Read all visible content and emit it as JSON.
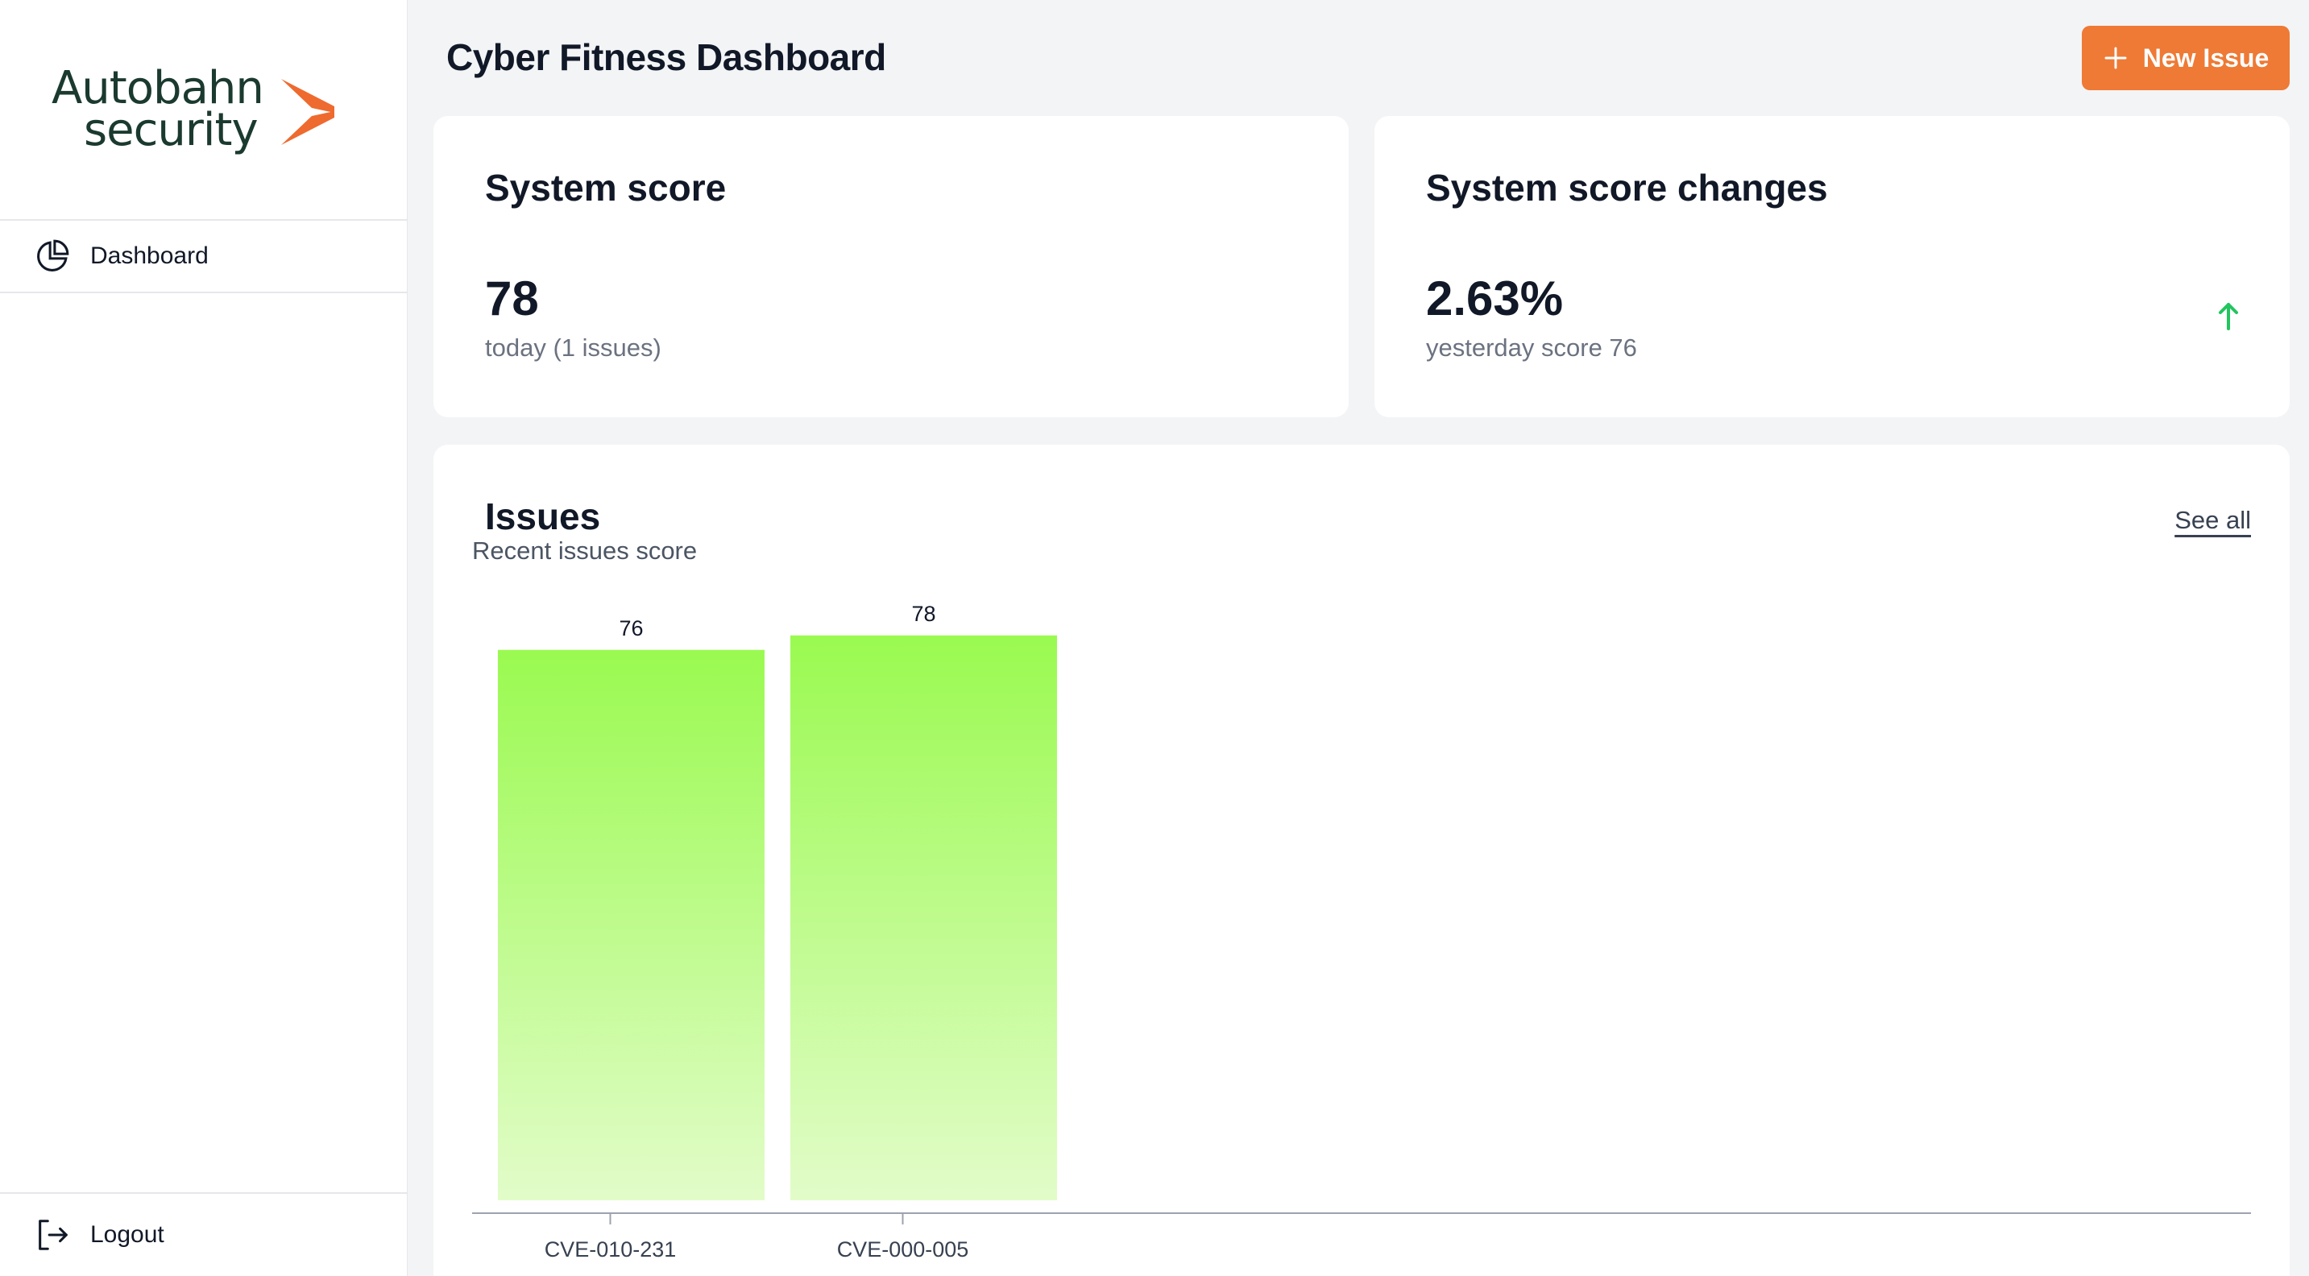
{
  "brand": {
    "logo_line1": "Autobahn",
    "logo_line2": "security",
    "accent_color": "#ee7a35"
  },
  "sidebar": {
    "items": [
      {
        "label": "Dashboard",
        "icon": "pie-chart-icon"
      }
    ],
    "logout_label": "Logout",
    "logout_icon": "logout-icon"
  },
  "header": {
    "title": "Cyber Fitness Dashboard",
    "new_issue_label": "New Issue",
    "new_issue_icon": "plus-icon"
  },
  "score_card": {
    "title": "System score",
    "value": "78",
    "subtitle": "today (1 issues)"
  },
  "change_card": {
    "title": "System score changes",
    "value": "2.63%",
    "subtitle": "yesterday score 76",
    "trend_icon": "arrow-up-icon",
    "trend_color": "#22c55e"
  },
  "issues": {
    "title": "Issues",
    "subtitle": "Recent issues score",
    "see_all_label": "See all"
  },
  "chart_data": {
    "type": "bar",
    "categories": [
      "CVE-010-231",
      "CVE-000-005"
    ],
    "values": [
      76,
      78
    ],
    "data_labels": [
      "76",
      "78"
    ],
    "bar_color_top": "#9afa50",
    "bar_color_bottom": "#e2fcc9",
    "axis_color": "#9ca3af"
  }
}
